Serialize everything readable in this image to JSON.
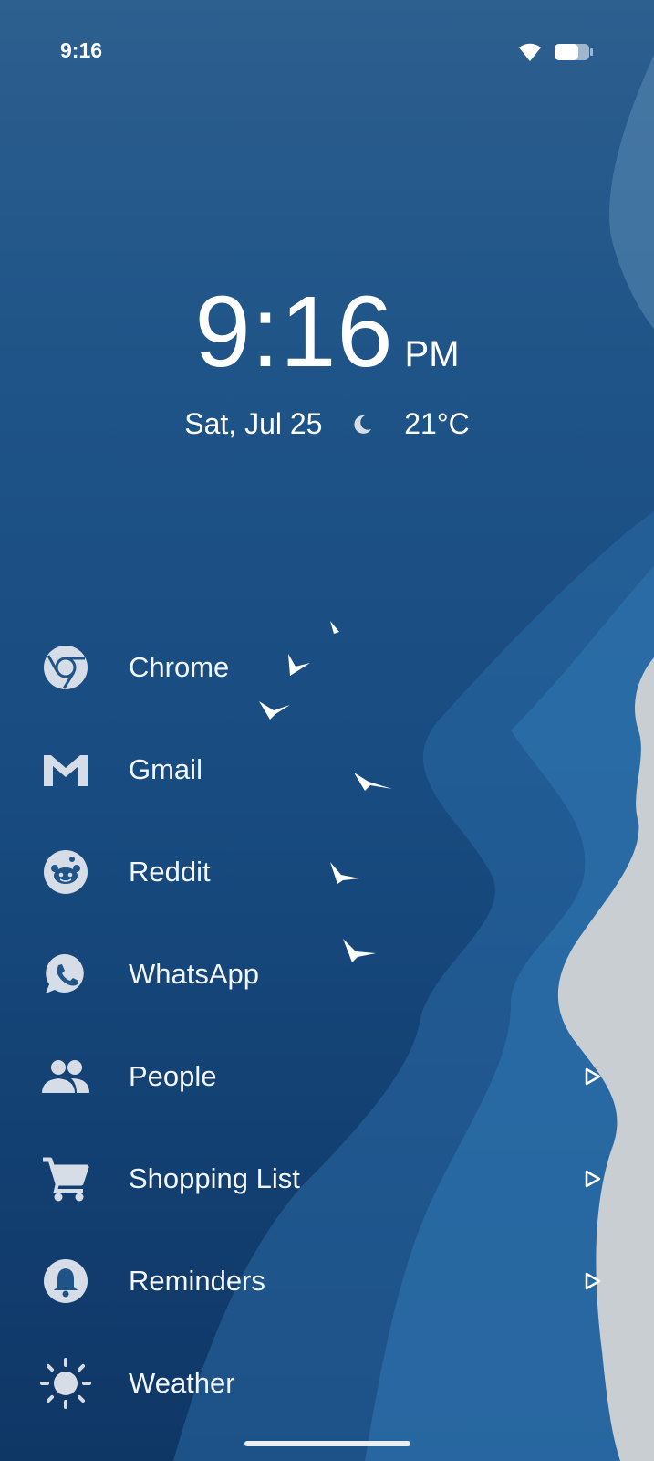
{
  "status_bar": {
    "time": "9:16",
    "icons": [
      "wifi-icon",
      "battery-icon"
    ]
  },
  "clock": {
    "time": "9:16",
    "ampm": "PM",
    "date": "Sat, Jul 25",
    "weather_icon": "moon-icon",
    "temperature": "21°C"
  },
  "apps": [
    {
      "label": "Chrome",
      "icon": "chrome-icon",
      "has_arrow": false
    },
    {
      "label": "Gmail",
      "icon": "gmail-icon",
      "has_arrow": false
    },
    {
      "label": "Reddit",
      "icon": "reddit-icon",
      "has_arrow": false
    },
    {
      "label": "WhatsApp",
      "icon": "whatsapp-icon",
      "has_arrow": false
    },
    {
      "label": "People",
      "icon": "people-icon",
      "has_arrow": true
    },
    {
      "label": "Shopping List",
      "icon": "shopping-cart-icon",
      "has_arrow": true
    },
    {
      "label": "Reminders",
      "icon": "bell-icon",
      "has_arrow": true
    },
    {
      "label": "Weather",
      "icon": "sun-icon",
      "has_arrow": false
    }
  ],
  "colors": {
    "icon_fill": "#d6dde6",
    "text": "#ffffff",
    "sky": "#1f5488",
    "shore": "#c9ced3"
  }
}
